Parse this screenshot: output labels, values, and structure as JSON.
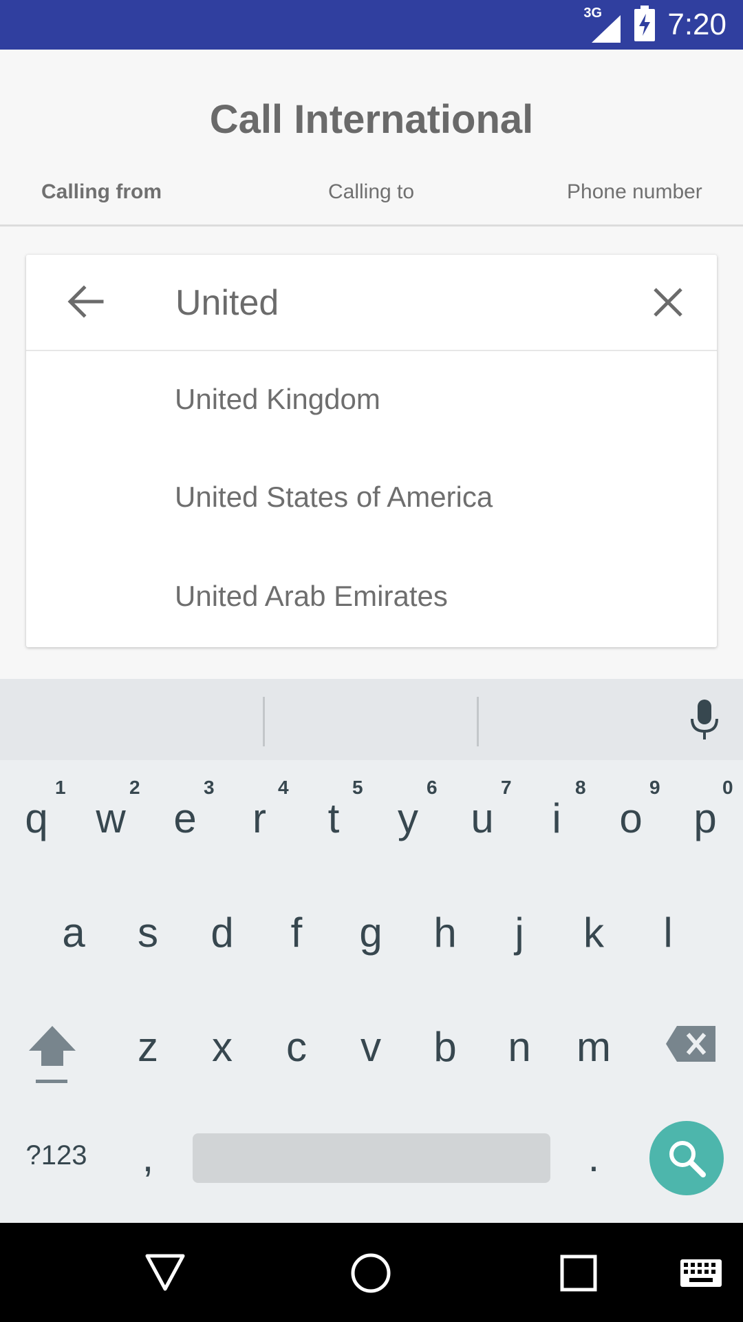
{
  "status_bar": {
    "network": "3G",
    "time": "7:20"
  },
  "header": {
    "title": "Call International"
  },
  "tabs": [
    {
      "label": "Calling from",
      "active": true
    },
    {
      "label": "Calling to",
      "active": false
    },
    {
      "label": "Phone number",
      "active": false
    }
  ],
  "search": {
    "value": "United"
  },
  "results": [
    {
      "label": "United Kingdom"
    },
    {
      "label": "United States of America"
    },
    {
      "label": "United Arab Emirates"
    }
  ],
  "keyboard": {
    "row1": [
      {
        "key": "q",
        "hint": "1"
      },
      {
        "key": "w",
        "hint": "2"
      },
      {
        "key": "e",
        "hint": "3"
      },
      {
        "key": "r",
        "hint": "4"
      },
      {
        "key": "t",
        "hint": "5"
      },
      {
        "key": "y",
        "hint": "6"
      },
      {
        "key": "u",
        "hint": "7"
      },
      {
        "key": "i",
        "hint": "8"
      },
      {
        "key": "o",
        "hint": "9"
      },
      {
        "key": "p",
        "hint": "0"
      }
    ],
    "row2": [
      "a",
      "s",
      "d",
      "f",
      "g",
      "h",
      "j",
      "k",
      "l"
    ],
    "row3": [
      "z",
      "x",
      "c",
      "v",
      "b",
      "n",
      "m"
    ],
    "symbols_label": "?123",
    "comma": ",",
    "period": "."
  },
  "colors": {
    "status_bar": "#303f9f",
    "accent": "#4db6ac"
  },
  "icons": {
    "back": "arrow-back-icon",
    "clear": "close-icon",
    "mic": "mic-icon",
    "shift": "shift-icon",
    "backspace": "backspace-icon",
    "search": "search-icon",
    "nav_back": "nav-back-icon",
    "nav_home": "nav-home-icon",
    "nav_recents": "nav-recents-icon",
    "nav_keyboard": "keyboard-icon"
  }
}
